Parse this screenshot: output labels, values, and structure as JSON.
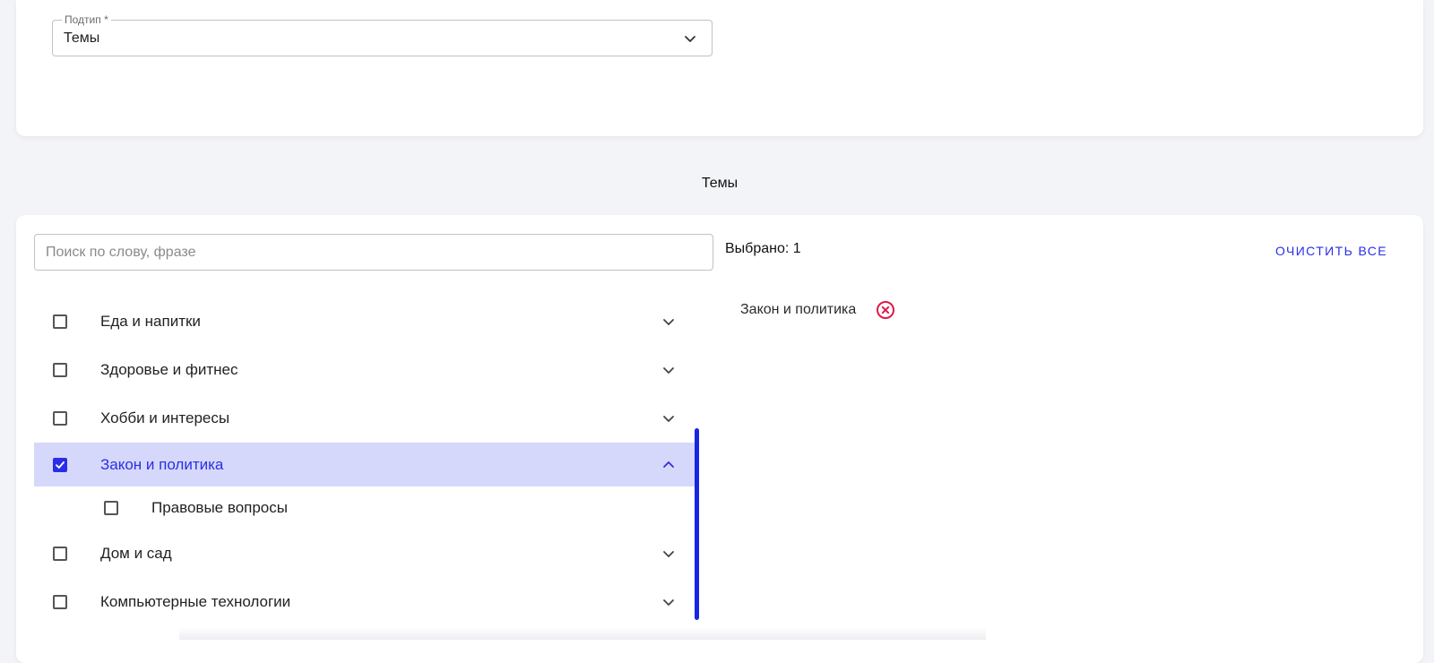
{
  "subtype_select": {
    "label": "Подтип *",
    "value": "Темы"
  },
  "section_title": "Темы",
  "search": {
    "placeholder": "Поиск по слову, фразе",
    "value": ""
  },
  "selected": {
    "count_label": "Выбрано: 1",
    "clear_all_label": "ОЧИСТИТЬ ВСЕ",
    "chips": [
      {
        "label": "Закон и политика"
      }
    ]
  },
  "tree": {
    "items": [
      {
        "label": "Еда и напитки",
        "checked": false,
        "expanded": false
      },
      {
        "label": "Здоровье и фитнес",
        "checked": false,
        "expanded": false
      },
      {
        "label": "Хобби и интересы",
        "checked": false,
        "expanded": false
      },
      {
        "label": "Закон и политика",
        "checked": true,
        "expanded": true,
        "children": [
          {
            "label": "Правовые вопросы",
            "checked": false
          }
        ]
      },
      {
        "label": "Дом и сад",
        "checked": false,
        "expanded": false
      },
      {
        "label": "Компьютерные технологии",
        "checked": false,
        "expanded": false
      }
    ]
  },
  "colors": {
    "accent": "#2a2ee8",
    "active_row_bg": "#d6d8fb",
    "remove_icon": "#e0184a",
    "page_bg": "#f3f4f8"
  },
  "icons": {
    "select_chevron": "chevron-down-icon",
    "collapsed_row": "chevron-down-icon",
    "expanded_row": "chevron-up-icon",
    "chip_remove": "close-circle-icon",
    "checkbox_checked": "check-icon"
  }
}
